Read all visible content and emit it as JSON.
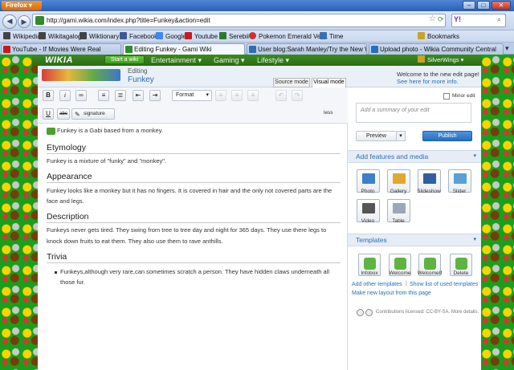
{
  "browser": {
    "firefox_button": "Firefox",
    "url": "http://gami.wikia.com/index.php?title=Funkey&action=edit",
    "search_placeholder": "Y!",
    "bookmarks": [
      {
        "label": "Wikipedia",
        "color": "#444444"
      },
      {
        "label": "Wikitagalog",
        "color": "#444444"
      },
      {
        "label": "Wiktionary",
        "color": "#444444"
      },
      {
        "label": "Facebook",
        "color": "#3b5998"
      },
      {
        "label": "Google",
        "color": "#4285f4"
      },
      {
        "label": "Youtube",
        "color": "#cc181e"
      },
      {
        "label": "Serebii",
        "color": "#2a7a2a"
      },
      {
        "label": "Pokemon Emerald Ver...",
        "color": "#d03030"
      },
      {
        "label": "Time",
        "color": "#3a6fb0"
      }
    ],
    "bookmarks_menu": "Bookmarks",
    "tabs": [
      {
        "label": "YouTube - If Movies Were Real",
        "color": "#cc181e",
        "active": false
      },
      {
        "label": "Editing Funkey - Gami Wiki",
        "color": "#2e8b2e",
        "active": true
      },
      {
        "label": "User blog:Sarah Manley/Try the New W...",
        "color": "#2b6fb6",
        "active": false
      },
      {
        "label": "Upload photo - Wikia Community Central",
        "color": "#2b6fb6",
        "active": false
      }
    ]
  },
  "wikia": {
    "logo": "WIKIA",
    "start_wiki": "Start a wiki",
    "nav": [
      "Entertainment",
      "Gaming",
      "Lifestyle"
    ],
    "user": "SilverWings"
  },
  "editor": {
    "editing_label": "Editing",
    "page_name": "Funkey",
    "source_mode": "Source mode",
    "visual_mode": "Visual mode",
    "format_label": "Format",
    "signature_label": "signature",
    "less_label": "less",
    "intro": "Funkey is a Gabi based from a monkey.",
    "sections": [
      {
        "heading": "Etymology",
        "paragraphs": [
          "Funkey is a mixture of \"funky\" and \"monkey\"."
        ]
      },
      {
        "heading": "Appearance",
        "paragraphs": [
          "Funkey looks like a monkey but it has no fingers. It is covered in hair and the only not covered parts are the",
          "face and legs."
        ]
      },
      {
        "heading": "Description",
        "paragraphs": [
          "Funkeys never gets tired. They swing from tree to tree day and night for 365 days. They use there legs to",
          "knock down fruits to eat them. They also use them to rave anthills."
        ]
      },
      {
        "heading": "Trivia",
        "bullets": [
          "Funkeys,although very rare,can sometimes scratch a person. They have hidden claws underneath all",
          "those fur."
        ]
      }
    ]
  },
  "rail": {
    "welcome_text": "Welcome to the new edit page!",
    "see_here": "See here for more info.",
    "minor_edit": "Minor edit",
    "summary_placeholder": "Add a summary of your edit",
    "preview": "Preview",
    "publish": "Publish",
    "features_title": "Add features and media",
    "media": [
      {
        "label": "Photo",
        "color": "#3f7fc9"
      },
      {
        "label": "Gallery",
        "color": "#e0a92e"
      },
      {
        "label": "Slideshow",
        "color": "#2f5f9f"
      },
      {
        "label": "Slider",
        "color": "#5aa0d8"
      },
      {
        "label": "Video",
        "color": "#555555"
      },
      {
        "label": "Table",
        "color": "#9aa7b8"
      }
    ],
    "templates_title": "Templates",
    "templates": [
      "Infobox",
      "Welcome",
      "WelcomeIf",
      "Delete"
    ],
    "add_other_templates": "Add other templates",
    "show_list": "Show list of used templates",
    "make_layout": "Make new layout from this page",
    "license": "Contributions licensed: CC-BY-SA. More details."
  }
}
